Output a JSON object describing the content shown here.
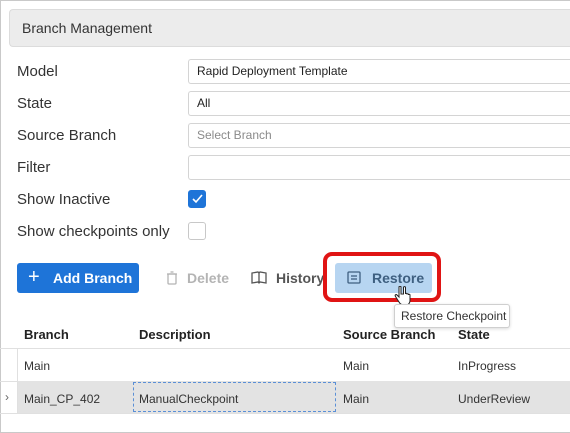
{
  "header": {
    "title": "Branch Management"
  },
  "form": {
    "model_label": "Model",
    "model_value": "Rapid Deployment Template",
    "state_label": "State",
    "state_value": "All",
    "source_branch_label": "Source Branch",
    "source_branch_placeholder": "Select Branch",
    "filter_label": "Filter",
    "filter_value": "",
    "show_inactive_label": "Show Inactive",
    "show_inactive_checked": true,
    "show_checkpoints_label": "Show checkpoints only",
    "show_checkpoints_checked": false
  },
  "toolbar": {
    "add_label": "Add Branch",
    "delete_label": "Delete",
    "history_label": "History",
    "restore_label": "Restore",
    "restore_tooltip": "Restore Checkpoint"
  },
  "table": {
    "headers": [
      "Branch",
      "Description",
      "Source Branch",
      "State"
    ],
    "rows": [
      {
        "branch": "Main",
        "description": "",
        "source": "Main",
        "state": "InProgress"
      },
      {
        "branch": "Main_CP_402",
        "description": "ManualCheckpoint",
        "source": "Main",
        "state": "UnderReview"
      }
    ]
  },
  "colors": {
    "accent": "#1e74d8",
    "restore_bg": "#b7d5f1",
    "highlight": "#e01414"
  }
}
